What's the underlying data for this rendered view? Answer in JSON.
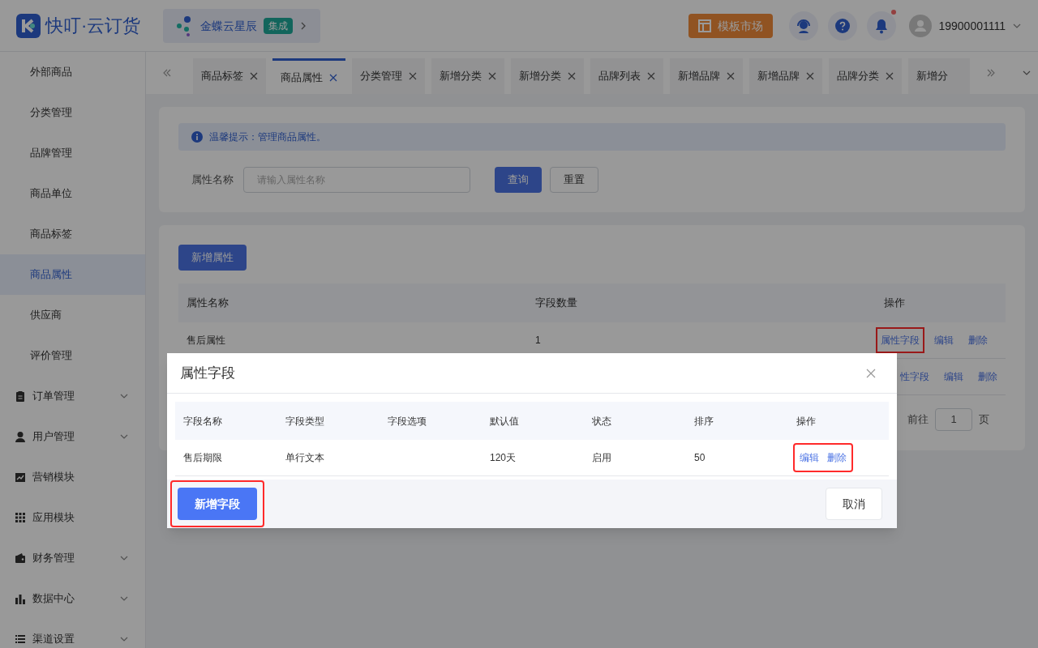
{
  "header": {
    "logo_text": "快叮·云订货",
    "integration": {
      "name": "金蝶云星辰",
      "badge": "集成"
    },
    "template_market": "模板市场",
    "notification_dot": true,
    "user": "19900001111"
  },
  "sidebar": {
    "items": [
      {
        "label": "外部商品",
        "kind": "sub",
        "selected": false
      },
      {
        "label": "分类管理",
        "kind": "sub",
        "selected": false
      },
      {
        "label": "品牌管理",
        "kind": "sub",
        "selected": false
      },
      {
        "label": "商品单位",
        "kind": "sub",
        "selected": false
      },
      {
        "label": "商品标签",
        "kind": "sub",
        "selected": false
      },
      {
        "label": "商品属性",
        "kind": "sub",
        "selected": true
      },
      {
        "label": "供应商",
        "kind": "sub",
        "selected": false
      },
      {
        "label": "评价管理",
        "kind": "sub",
        "selected": false
      },
      {
        "label": "订单管理",
        "kind": "group",
        "expandable": true,
        "selected": false
      },
      {
        "label": "用户管理",
        "kind": "group",
        "expandable": true,
        "selected": false
      },
      {
        "label": "营销模块",
        "kind": "group",
        "expandable": false,
        "selected": false
      },
      {
        "label": "应用模块",
        "kind": "group",
        "expandable": false,
        "selected": false
      },
      {
        "label": "财务管理",
        "kind": "group",
        "expandable": true,
        "selected": false
      },
      {
        "label": "数据中心",
        "kind": "group",
        "expandable": true,
        "selected": false
      },
      {
        "label": "渠道设置",
        "kind": "group",
        "expandable": true,
        "selected": false
      }
    ]
  },
  "tabs": [
    {
      "label": "商品标签",
      "selected": false
    },
    {
      "label": "商品属性",
      "selected": true
    },
    {
      "label": "分类管理",
      "selected": false
    },
    {
      "label": "新增分类",
      "selected": false
    },
    {
      "label": "新增分类",
      "selected": false
    },
    {
      "label": "品牌列表",
      "selected": false
    },
    {
      "label": "新增品牌",
      "selected": false
    },
    {
      "label": "新增品牌",
      "selected": false
    },
    {
      "label": "品牌分类",
      "selected": false
    },
    {
      "label": "新增分",
      "selected": false
    }
  ],
  "notice": "温馨提示：管理商品属性。",
  "filter": {
    "label": "属性名称",
    "placeholder": "请输入属性名称",
    "buttons": [
      "查询",
      "重置"
    ]
  },
  "attributes": {
    "add_button": "新增属性",
    "columns": [
      "属性名称",
      "字段数量",
      "操作"
    ],
    "rows": [
      {
        "cells": [
          "售后属性",
          "1"
        ],
        "actions": [
          {
            "label": "属性字段",
            "highlighted": true
          },
          {
            "label": "编辑",
            "highlighted": false
          },
          {
            "label": "删除",
            "highlighted": false
          }
        ]
      },
      {
        "actions": [
          {
            "label": "性字段",
            "highlighted": false
          },
          {
            "label": "编辑",
            "highlighted": false
          },
          {
            "label": "删除",
            "highlighted": false
          }
        ]
      }
    ],
    "pagination": {
      "goto_label": "前往",
      "page": "1",
      "page_suffix": "页"
    }
  },
  "dialog": {
    "title": "属性字段",
    "columns": [
      "字段名称",
      "字段类型",
      "字段选项",
      "默认值",
      "状态",
      "排序",
      "操作"
    ],
    "rows": [
      {
        "cells": [
          "售后期限",
          "单行文本",
          null,
          "120天",
          "启用",
          "50"
        ],
        "actions": [
          "编辑",
          "删除"
        ],
        "actions_highlighted": true
      }
    ],
    "add_button": {
      "label": "新增字段",
      "highlighted": true
    },
    "cancel_button": "取消"
  }
}
